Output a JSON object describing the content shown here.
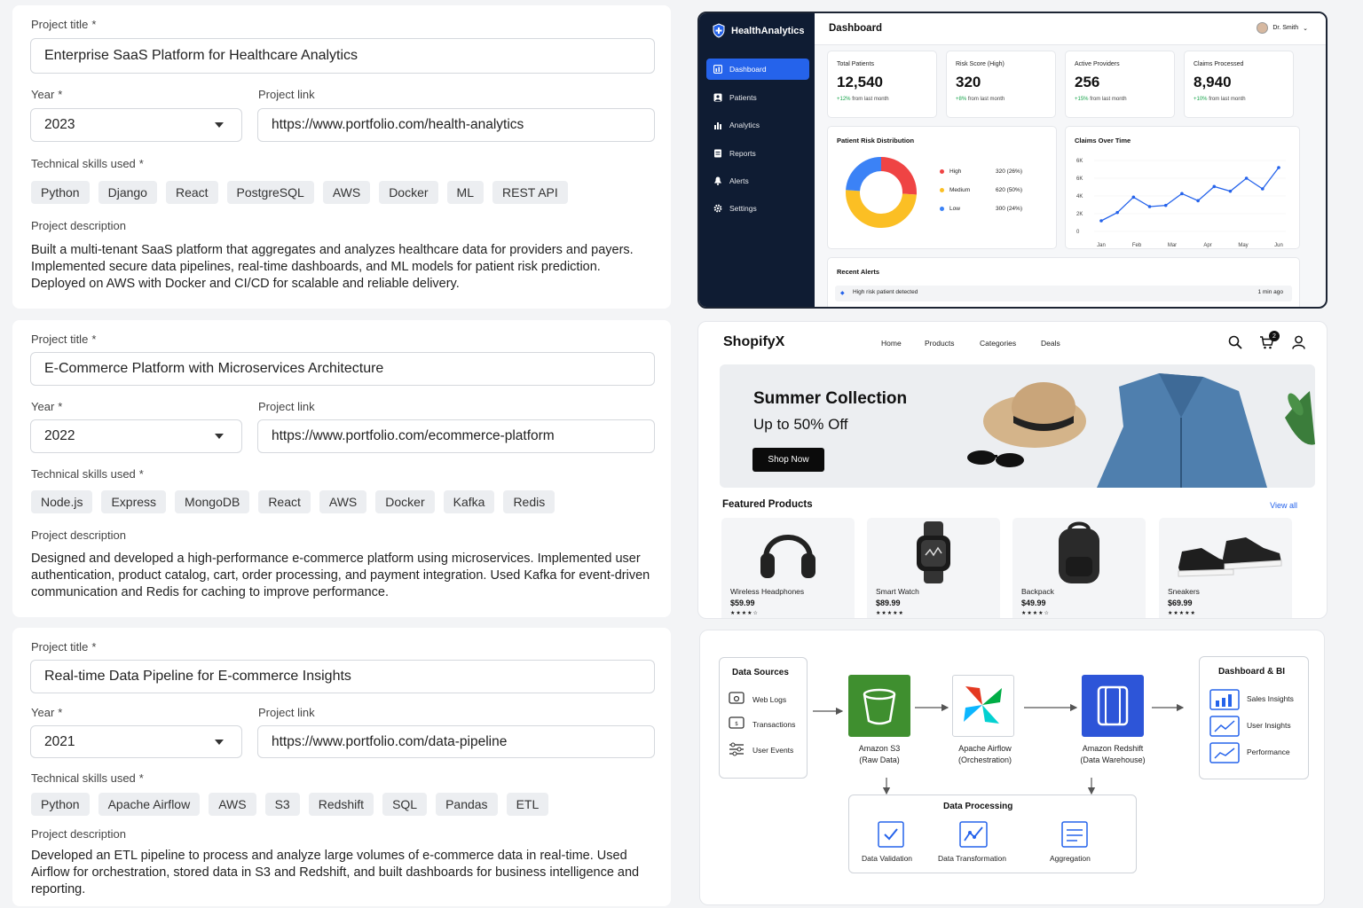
{
  "projects": [
    {
      "title_label": "Project title",
      "title": "Enterprise SaaS Platform for Healthcare Analytics",
      "year_label": "Year",
      "year": "2023",
      "link_label": "Project link",
      "link": "https://www.portfolio.com/health-analytics",
      "skills_label": "Technical skills used",
      "skills": [
        "Python",
        "Django",
        "React",
        "PostgreSQL",
        "AWS",
        "Docker",
        "ML",
        "REST API"
      ],
      "desc_label": "Project description",
      "description": "Built a multi-tenant SaaS platform that aggregates and analyzes healthcare data for providers and payers. Implemented secure data pipelines, real-time dashboards, and ML models for patient risk prediction. Deployed on AWS with Docker and CI/CD for scalable and reliable delivery."
    },
    {
      "title_label": "Project title",
      "title": "E-Commerce Platform with Microservices Architecture",
      "year_label": "Year",
      "year": "2022",
      "link_label": "Project link",
      "link": "https://www.portfolio.com/ecommerce-platform",
      "skills_label": "Technical skills used",
      "skills": [
        "Node.js",
        "Express",
        "MongoDB",
        "React",
        "AWS",
        "Docker",
        "Kafka",
        "Redis"
      ],
      "desc_label": "Project description",
      "description": "Designed and developed a high-performance e-commerce platform using microservices. Implemented user authentication, product catalog, cart, order processing, and payment integration. Used Kafka for event-driven communication and Redis for caching to improve performance."
    },
    {
      "title_label": "Project title",
      "title": "Real-time Data Pipeline for E-commerce Insights",
      "year_label": "Year",
      "year": "2021",
      "link_label": "Project link",
      "link": "https://www.portfolio.com/data-pipeline",
      "skills_label": "Technical skills used",
      "skills": [
        "Python",
        "Apache Airflow",
        "AWS",
        "S3",
        "Redshift",
        "SQL",
        "Pandas",
        "ETL"
      ],
      "desc_label": "Project description",
      "description": "Developed an ETL pipeline to process and analyze large volumes of e-commerce data in real-time. Used Airflow for orchestration, stored data in S3 and Redshift, and built dashboards for business intelligence and reporting."
    }
  ],
  "required_mark": "*",
  "health": {
    "brand": "HealthAnalytics",
    "nav": [
      "Dashboard",
      "Patients",
      "Analytics",
      "Reports",
      "Alerts",
      "Settings"
    ],
    "title": "Dashboard",
    "user": "Dr. Smith",
    "stats": [
      {
        "label": "Total Patients",
        "value": "12,540",
        "change": "+12%",
        "suffix": "from last month"
      },
      {
        "label": "Risk Score (High)",
        "value": "320",
        "change": "+8%",
        "suffix": "from last month"
      },
      {
        "label": "Active Providers",
        "value": "256",
        "change": "+15%",
        "suffix": "from last month"
      },
      {
        "label": "Claims Processed",
        "value": "8,940",
        "change": "+10%",
        "suffix": "from last month"
      }
    ],
    "risk_title": "Patient Risk Distribution",
    "risk_legend": [
      {
        "name": "High",
        "value": "320 (26%)",
        "color": "#ef4444"
      },
      {
        "name": "Medium",
        "value": "620 (50%)",
        "color": "#fbbf24"
      },
      {
        "name": "Low",
        "value": "300 (24%)",
        "color": "#3b82f6"
      }
    ],
    "claims_title": "Claims Over Time",
    "recent_title": "Recent Alerts",
    "alert_text": "High risk patient detected",
    "alert_time": "1 min ago"
  },
  "chart_data": [
    {
      "type": "pie",
      "title": "Patient Risk Distribution",
      "categories": [
        "High",
        "Medium",
        "Low"
      ],
      "values": [
        26,
        50,
        24
      ],
      "counts": [
        320,
        620,
        300
      ],
      "colors": [
        "#ef4444",
        "#fbbf24",
        "#3b82f6"
      ]
    },
    {
      "type": "line",
      "title": "Claims Over Time",
      "x_ticks": [
        "Jan",
        "Feb",
        "Mar",
        "Apr",
        "May",
        "Jun"
      ],
      "y_ticks": [
        "6K",
        "6K",
        "4K",
        "2K",
        "0"
      ],
      "x": [
        0,
        0.5,
        1,
        1.5,
        2,
        2.5,
        3,
        3.5,
        4,
        4.5,
        5
      ],
      "y": [
        0.9,
        1.6,
        2.9,
        2.1,
        2.2,
        3.2,
        2.6,
        3.8,
        3.4,
        4.5,
        3.6,
        5.4
      ],
      "series": [
        {
          "values": [
            900,
            1600,
            2900,
            2100,
            2200,
            3200,
            2600,
            3800,
            3400,
            4500,
            3600,
            5400
          ]
        }
      ],
      "ylim": [
        0,
        6000
      ],
      "color": "#2563eb"
    }
  ],
  "shop": {
    "logo": "ShopifyX",
    "menu": [
      "Home",
      "Products",
      "Categories",
      "Deals"
    ],
    "cart_count": "2",
    "hero_title": "Summer Collection",
    "hero_sub": "Up to 50% Off",
    "hero_button": "Shop Now",
    "featured": "Featured Products",
    "view_all": "View all",
    "products": [
      {
        "name": "Wireless Headphones",
        "price": "$59.99",
        "rating": "★★★★☆"
      },
      {
        "name": "Smart Watch",
        "price": "$89.99",
        "rating": "★★★★★"
      },
      {
        "name": "Backpack",
        "price": "$49.99",
        "rating": "★★★★☆"
      },
      {
        "name": "Sneakers",
        "price": "$69.99",
        "rating": "★★★★★"
      }
    ]
  },
  "pipeline": {
    "sources_title": "Data Sources",
    "sources": [
      "Web Logs",
      "Transactions",
      "User Events"
    ],
    "s3": [
      "Amazon S3",
      "(Raw Data)"
    ],
    "airflow": [
      "Apache Airflow",
      "(Orchestration)"
    ],
    "redshift": [
      "Amazon Redshift",
      "(Data Warehouse)"
    ],
    "bi_title": "Dashboard & BI",
    "bi": [
      "Sales Insights",
      "User Insights",
      "Performance"
    ],
    "processing_title": "Data Processing",
    "processing": [
      "Data Validation",
      "Data Transformation",
      "Aggregation"
    ],
    "colors": {
      "s3": "#3f8f2f",
      "redshift": "#2d55d8",
      "accent": "#2563eb"
    }
  }
}
